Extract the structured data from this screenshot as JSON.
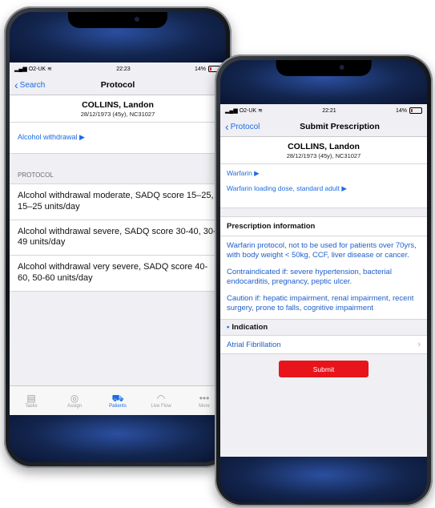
{
  "phone_left": {
    "status": {
      "carrier": "O2-UK",
      "time": "22:23",
      "battery": "14%"
    },
    "nav": {
      "back_label": "Search",
      "title": "Protocol"
    },
    "patient": {
      "name": "COLLINS, Landon",
      "details": "28/12/1973 (45y), NC31027"
    },
    "condition_link": "Alcohol withdrawal ▶",
    "section_label": "PROTOCOL",
    "protocols": [
      "Alcohol withdrawal moderate, SADQ score 15–25, 15–25 units/day",
      "Alcohol withdrawal severe, SADQ score 30-40, 30-49 units/day",
      "Alcohol withdrawal very severe, SADQ score 40-60, 50-60 units/day"
    ],
    "tabs": [
      {
        "label": "Tasks",
        "icon": "tasks-icon"
      },
      {
        "label": "Assign",
        "icon": "assign-icon"
      },
      {
        "label": "Patients",
        "icon": "patients-bed-icon"
      },
      {
        "label": "Live Flow",
        "icon": "live-flow-icon"
      },
      {
        "label": "More",
        "icon": "more-icon"
      }
    ],
    "active_tab": "Patients"
  },
  "phone_right": {
    "status": {
      "carrier": "O2-UK",
      "time": "22:21",
      "battery": "14%"
    },
    "nav": {
      "back_label": "Protocol",
      "title": "Submit Prescription"
    },
    "patient": {
      "name": "COLLINS, Landon",
      "details": "28/12/1973 (45y), NC31027"
    },
    "drug_link": "Warfarin ▶",
    "dose_link": "Warfarin loading dose, standard adult ▶",
    "info_header": "Prescription information",
    "info_paragraphs": [
      "Warfarin protocol, not to be used for patients over 70yrs, with body weight < 50kg, CCF, liver disease or cancer.",
      "Contraindicated if: severe hypertension, bacterial endocarditis, pregnancy, peptic ulcer.",
      "Caution if: hepatic impairment, renal impairment, recent surgery, prone to falls, cognitive impairment"
    ],
    "indication_header": "Indication",
    "indication_value": "Atrial Fibrillation",
    "submit_label": "Submit"
  },
  "colors": {
    "accent": "#1d6ce0",
    "submit": "#e8141c"
  }
}
